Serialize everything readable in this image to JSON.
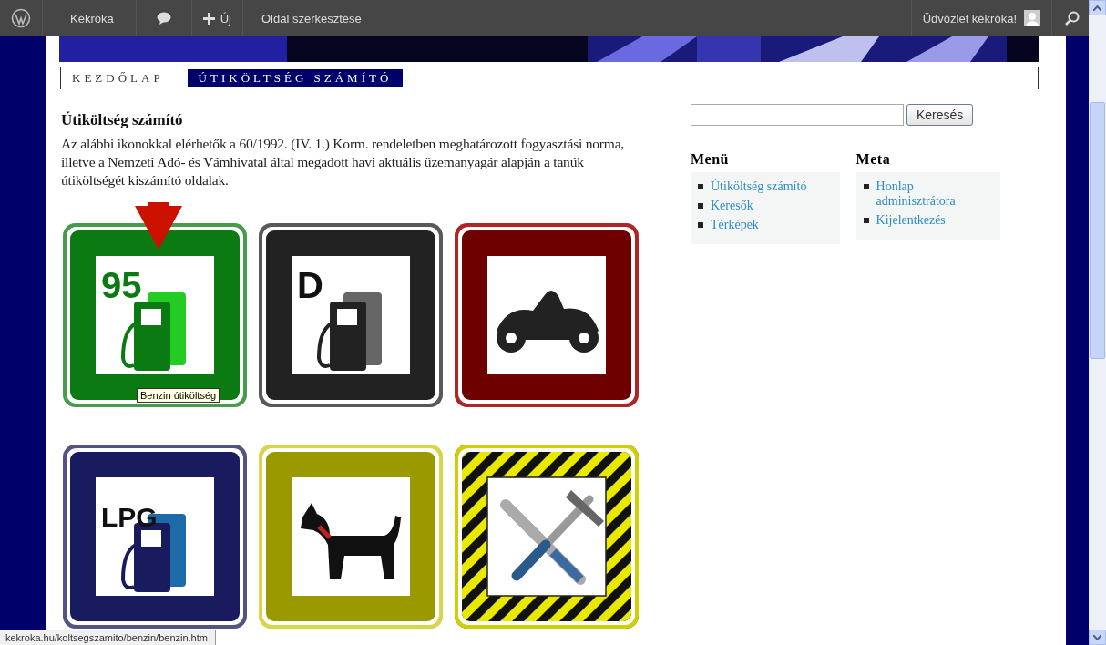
{
  "admin_bar": {
    "site_name": "Kékróka",
    "new_label": "Új",
    "edit_label": "Oldal szerkesztése",
    "greeting": "Üdvözlet kékróka!"
  },
  "nav": [
    {
      "label": "KEZDŐLAP",
      "selected": false
    },
    {
      "label": "ÚTIKÖLTSÉG SZÁMÍTÓ",
      "selected": true
    }
  ],
  "article": {
    "title": "Útiköltség számító",
    "body": "Az alábbi ikonokkal elérhetők a 60/1992. (IV. 1.) Korm. rendeletben meghatározott fogyasztási norma, illetve a Nemzeti Adó- és Vámhivatal által megadott havi aktuális üzemanyagár alapján a tanúk útiköltségét kiszámító oldalak."
  },
  "tiles": [
    {
      "kind": "fuel",
      "label": "95",
      "color": "#0b7a12"
    },
    {
      "kind": "fuel",
      "label": "D",
      "color": "#222222"
    },
    {
      "kind": "motorcycle",
      "color": "#6e0000"
    },
    {
      "kind": "fuel",
      "label": "LPG",
      "color": "#1a1a5e"
    },
    {
      "kind": "dog",
      "color": "#9a9a00"
    },
    {
      "kind": "tools",
      "color": "#111111"
    }
  ],
  "tooltip": "Benzin útiköltség",
  "search": {
    "button": "Keresés"
  },
  "widgets": [
    {
      "title": "Menü",
      "links": [
        "Útiköltség számító",
        "Keresők",
        "Térképek"
      ]
    },
    {
      "title": "Meta",
      "links": [
        "Honlap adminisztrátora",
        "Kijelentkezés"
      ]
    }
  ],
  "status_url": "kekroka.hu/koltsegszamito/benzin/benzin.htm"
}
